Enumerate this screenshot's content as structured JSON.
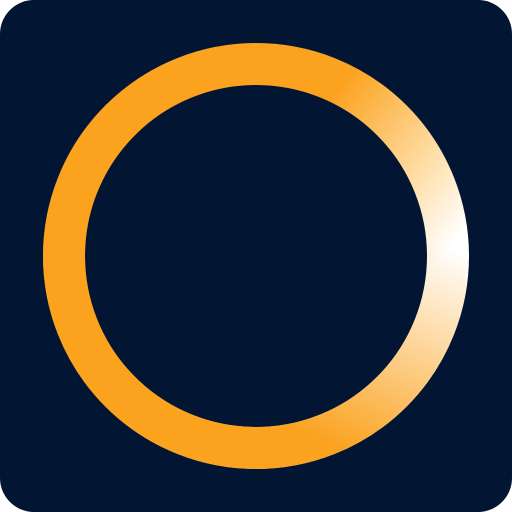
{
  "icon": {
    "name": "ring-logo-icon",
    "colors": {
      "background": "#021634",
      "ring_primary": "#FBA21E",
      "ring_highlight": "#FFFFFF"
    }
  }
}
